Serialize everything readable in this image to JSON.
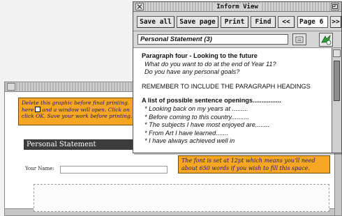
{
  "inform_view": {
    "title": "Inform View",
    "toolbar": {
      "save_all": "Save all",
      "save_page": "Save page",
      "print": "Print",
      "find": "Find",
      "prev": "<<",
      "page_label": "Page",
      "page_number": "6",
      "next": ">>"
    },
    "selector_value": "Personal Statement (3)",
    "content": {
      "heading": "Paragraph four - Looking to the future",
      "questions": [
        "What do you want to do at the end of Year 11?",
        "Do you have any personal goals?"
      ],
      "reminder": "REMEMBER TO INCLUDE THE PARAGRAPH HEADINGS",
      "list_heading": "A list of possible sentence openings................",
      "openings": [
        "* Looking back on my years at .........",
        "* Before coming to this country..........",
        "* The subjects I have most enjoyed are........",
        "* From Art I have learned.......",
        "* I have always achieved well in"
      ]
    },
    "icons": {
      "close": "close-icon",
      "toggle": "toggle-size-icon",
      "menu": "menu-icon",
      "run": "run-green-icon"
    }
  },
  "document": {
    "note_top_lines": [
      "Delete this graphic before final printing.",
      "and a window will open. Click on",
      "click OK. Save your work before printing."
    ],
    "note_top_prefix": "here",
    "section_title": "Personal Statement",
    "name_label": "Your Name:",
    "note_bottom": "The font is set at 12pt which means you'll need about 650 words if you wish to fill this space."
  },
  "colors": {
    "note_background": "#f5a623",
    "note_text": "#1a1a6a",
    "banner": "#3b3b3b",
    "run_icon_green": "#2e9e3a"
  }
}
